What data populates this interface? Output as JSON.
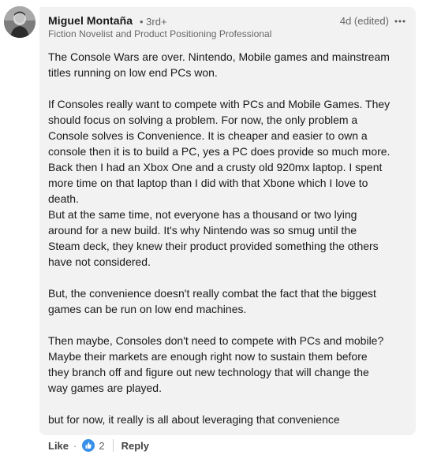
{
  "author": {
    "name": "Miguel Montaña",
    "degree": "3rd+",
    "headline": "Fiction Novelist and Product Positioning Professional"
  },
  "meta": {
    "timestamp": "4d (edited)",
    "more_icon": "ellipsis-icon"
  },
  "comment": {
    "paragraphs": [
      "The Console Wars are over. Nintendo, Mobile games and mainstream\ntitles running on low end PCs won.",
      "If Consoles really want to compete with PCs and Mobile Games. They\nshould focus on solving a problem. For now, the only problem a\nConsole solves is Convenience. It is cheaper and easier to own a\nconsole then it is to build a PC, yes a PC does provide so much more.\nBack then I had an Xbox One and a crusty old 920mx laptop. I spent\nmore time on that laptop than I did with that Xbone which I love to\ndeath.\n But at the same time, not everyone has a thousand or two lying\naround for a new build. It's why Nintendo was so smug until the\nSteam deck, they knew their product provided something the others\nhave not considered.",
      "But, the convenience doesn't really combat the fact that the biggest\ngames can be run on low end machines.",
      "Then maybe, Consoles don't need to compete with PCs and mobile?\nMaybe their markets are enough right now to sustain them before\nthey branch off and figure out new technology that will change the\nway games are played.",
      "but for now, it really is all about leveraging that convenience"
    ]
  },
  "actions": {
    "like_label": "Like",
    "separator": "·",
    "reaction_icon": "thumbs-up-icon",
    "reaction_count": "2",
    "reply_label": "Reply"
  },
  "colors": {
    "bubble_bg": "#f2f2f2",
    "like_blue": "#378fe9",
    "muted_text": "#666666"
  }
}
